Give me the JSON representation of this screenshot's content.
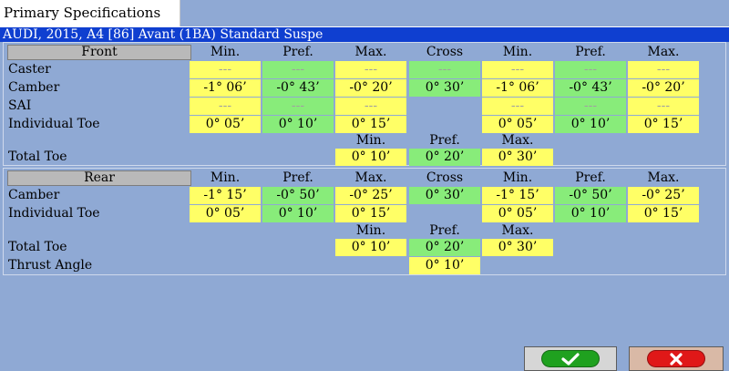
{
  "tab": {
    "title": "Primary Specifications"
  },
  "vehicle": {
    "title": "AUDI, 2015, A4 [86] Avant (1BA) Standard Suspe"
  },
  "front": {
    "header": "Front",
    "columns": {
      "min": "Min.",
      "pref": "Pref.",
      "max": "Max.",
      "cross": "Cross",
      "min2": "Min.",
      "pref2": "Pref.",
      "max2": "Max."
    },
    "rows": {
      "caster": {
        "label": "Caster",
        "l_min": "---",
        "l_pref": "---",
        "l_max": "---",
        "cross": "---",
        "r_min": "---",
        "r_pref": "---",
        "r_max": "---"
      },
      "camber": {
        "label": "Camber",
        "l_min": "-1° 06’",
        "l_pref": "-0° 43’",
        "l_max": "-0° 20’",
        "cross": "0° 30’",
        "r_min": "-1° 06’",
        "r_pref": "-0° 43’",
        "r_max": "-0° 20’"
      },
      "sai": {
        "label": "SAI",
        "l_min": "---",
        "l_pref": "---",
        "l_max": "---",
        "r_min": "---",
        "r_pref": "---",
        "r_max": "---"
      },
      "individual_toe": {
        "label": "Individual Toe",
        "l_min": "0° 05’",
        "l_pref": "0° 10’",
        "l_max": "0° 15’",
        "r_min": "0° 05’",
        "r_pref": "0° 10’",
        "r_max": "0° 15’"
      }
    },
    "total_toe": {
      "label": "Total Toe",
      "min_h": "Min.",
      "pref_h": "Pref.",
      "max_h": "Max.",
      "min": "0° 10’",
      "pref": "0° 20’",
      "max": "0° 30’"
    }
  },
  "rear": {
    "header": "Rear",
    "columns": {
      "min": "Min.",
      "pref": "Pref.",
      "max": "Max.",
      "cross": "Cross",
      "min2": "Min.",
      "pref2": "Pref.",
      "max2": "Max."
    },
    "rows": {
      "camber": {
        "label": "Camber",
        "l_min": "-1° 15’",
        "l_pref": "-0° 50’",
        "l_max": "-0° 25’",
        "cross": "0° 30’",
        "r_min": "-1° 15’",
        "r_pref": "-0° 50’",
        "r_max": "-0° 25’"
      },
      "individual_toe": {
        "label": "Individual Toe",
        "l_min": "0° 05’",
        "l_pref": "0° 10’",
        "l_max": "0° 15’",
        "r_min": "0° 05’",
        "r_pref": "0° 10’",
        "r_max": "0° 15’"
      }
    },
    "total_toe": {
      "label": "Total Toe",
      "min_h": "Min.",
      "pref_h": "Pref.",
      "max_h": "Max.",
      "min": "0° 10’",
      "pref": "0° 20’",
      "max": "0° 30’"
    },
    "thrust_angle": {
      "label": "Thrust Angle",
      "value": "0° 10’"
    }
  },
  "buttons": {
    "ok_icon": "checkmark-icon",
    "cancel_icon": "x-icon",
    "ok_color": "#1fa11f",
    "cancel_color": "#e01818"
  }
}
